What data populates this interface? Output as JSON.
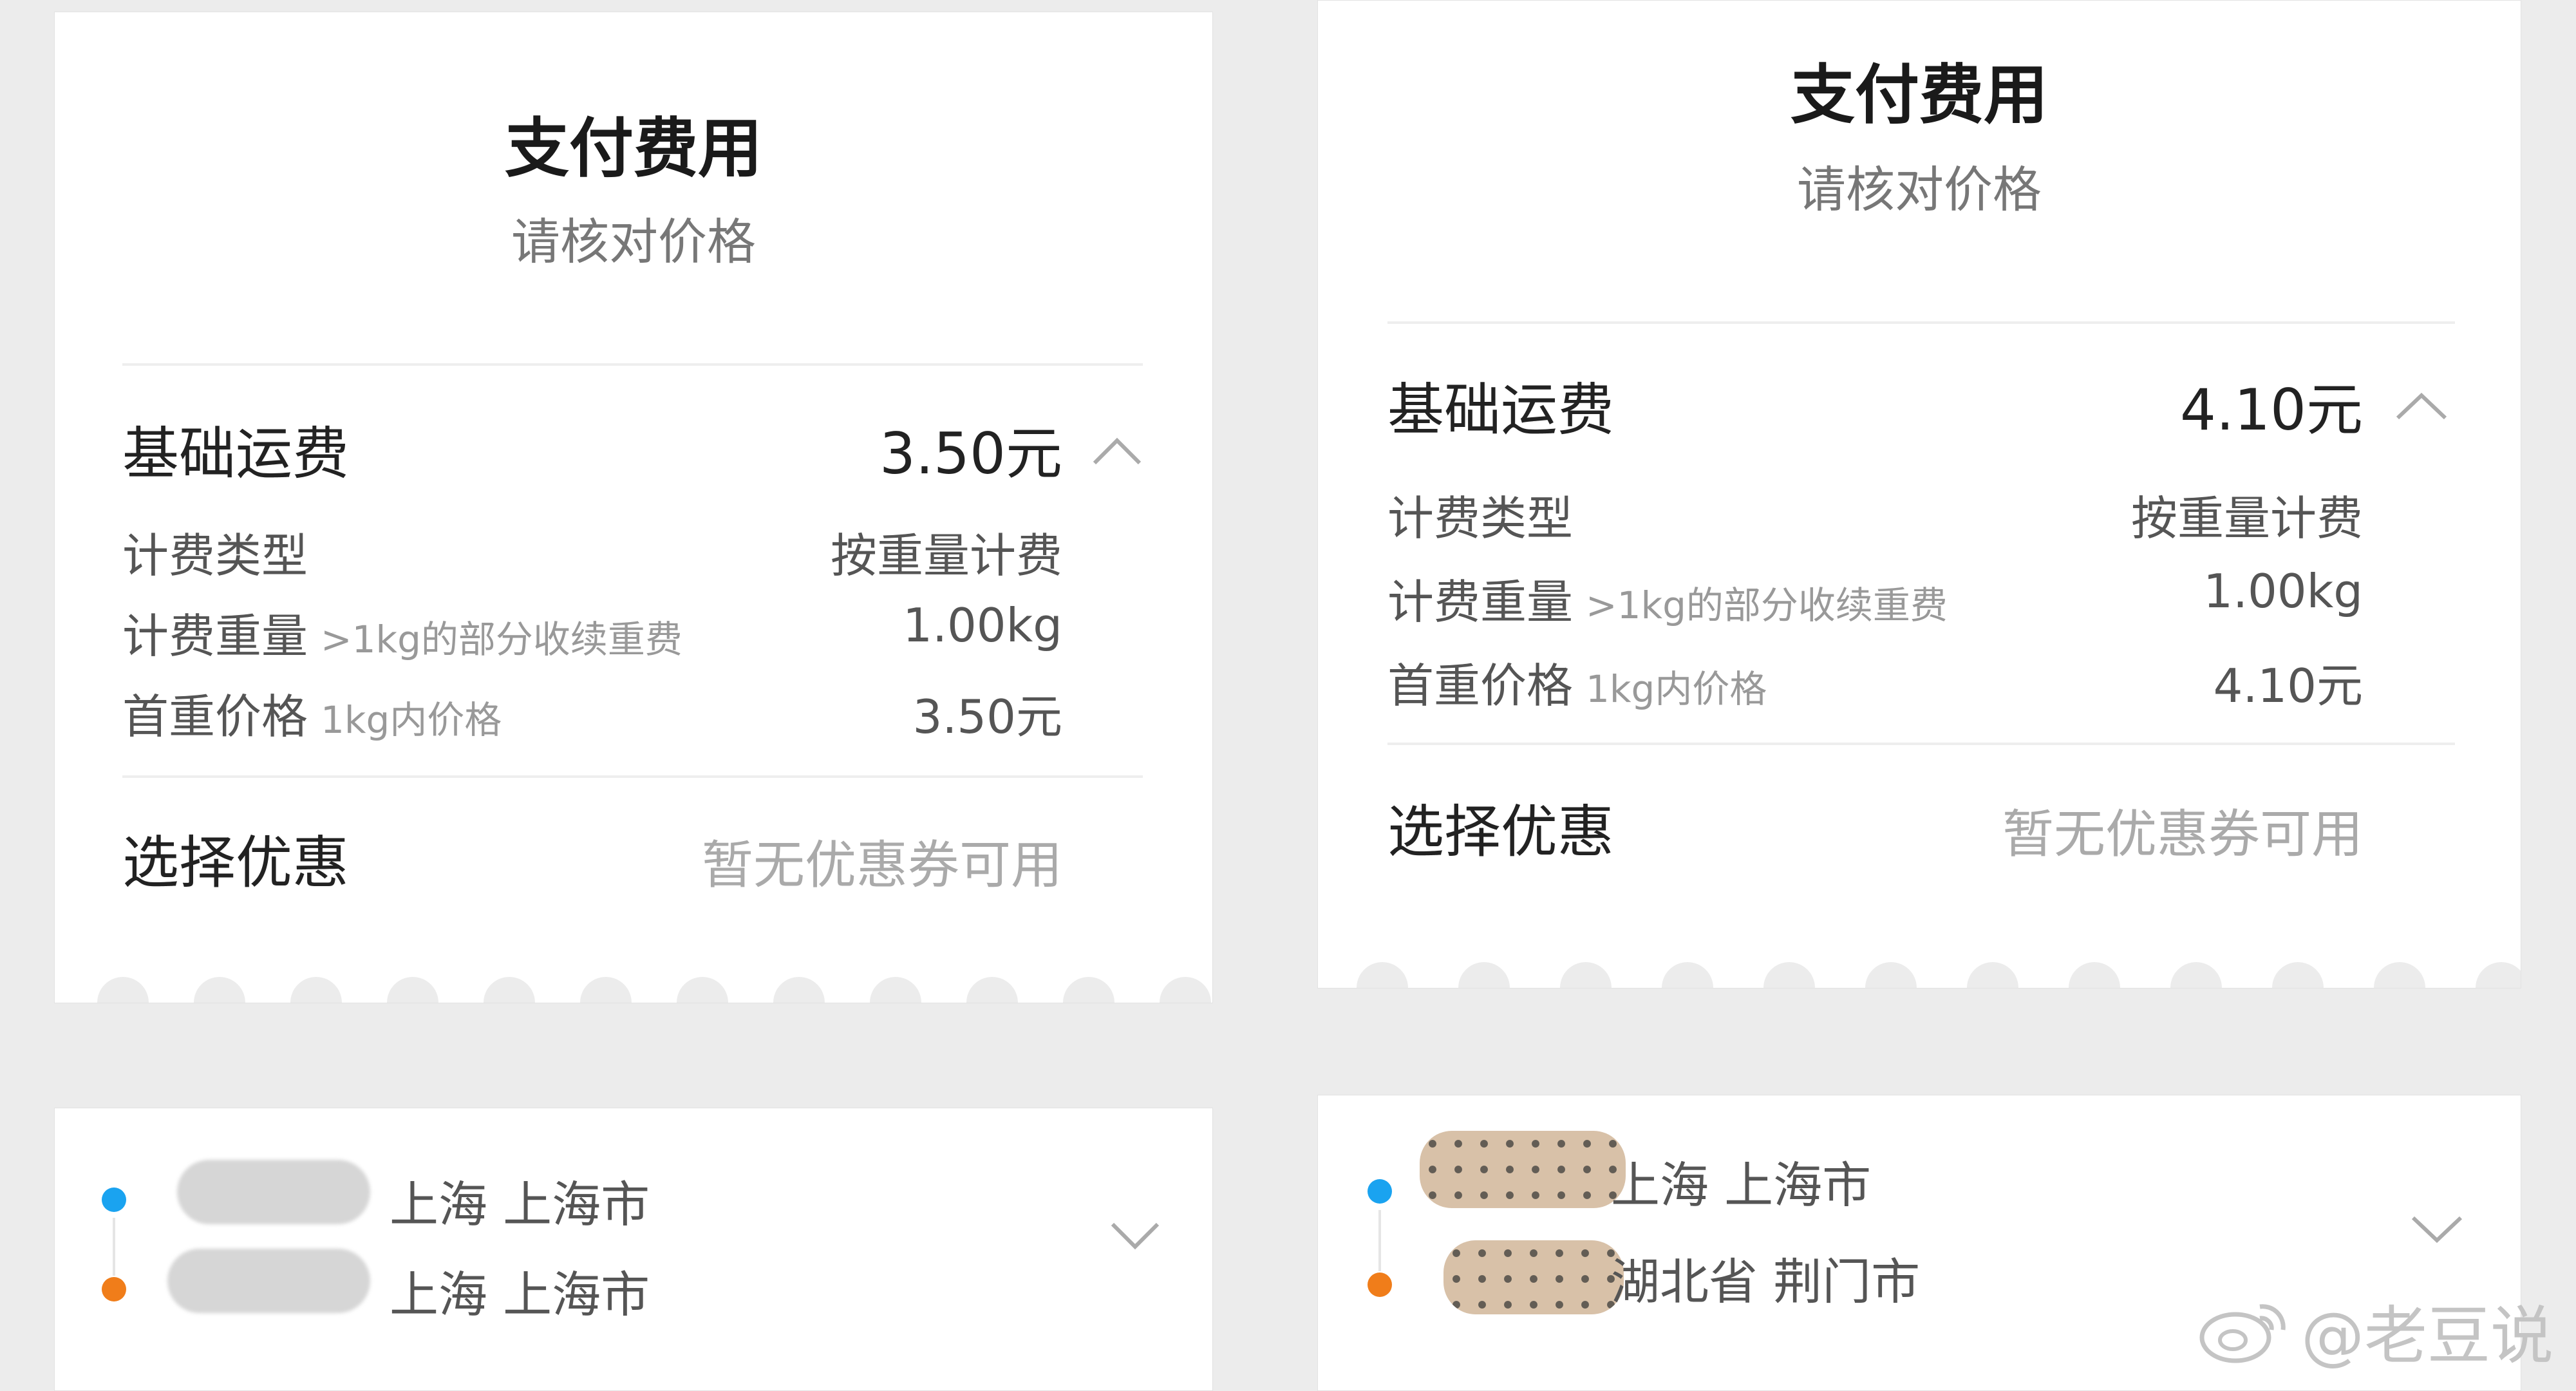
{
  "left": {
    "title": "支付费用",
    "subtitle": "请核对价格",
    "base_fee": {
      "label": "基础运费",
      "value": "3.50元"
    },
    "billing_type": {
      "label": "计费类型",
      "value": "按重量计费"
    },
    "billing_weight": {
      "label": "计费重量",
      "hint": ">1kg的部分收续重费",
      "value": "1.00kg"
    },
    "first_weight_price": {
      "label": "首重价格",
      "hint": "1kg内价格",
      "value": "3.50元"
    },
    "discount": {
      "label": "选择优惠",
      "value": "暂无优惠券可用"
    },
    "route": {
      "from": "上海 上海市",
      "to": "上海 上海市"
    }
  },
  "right": {
    "title": "支付费用",
    "subtitle": "请核对价格",
    "base_fee": {
      "label": "基础运费",
      "value": "4.10元"
    },
    "billing_type": {
      "label": "计费类型",
      "value": "按重量计费"
    },
    "billing_weight": {
      "label": "计费重量",
      "hint": ">1kg的部分收续重费",
      "value": "1.00kg"
    },
    "first_weight_price": {
      "label": "首重价格",
      "hint": "1kg内价格",
      "value": "4.10元"
    },
    "discount": {
      "label": "选择优惠",
      "value": "暂无优惠券可用"
    },
    "route": {
      "from": "上海 上海市",
      "to": "湖北省 荆门市"
    }
  },
  "watermark": "@老豆说",
  "colors": {
    "origin_dot": "#1aa3f0",
    "destination_dot": "#f07d1a"
  },
  "icons": {
    "collapse": "chevron-up-icon",
    "expand": "chevron-down-icon",
    "watermark_logo": "weibo-icon"
  }
}
